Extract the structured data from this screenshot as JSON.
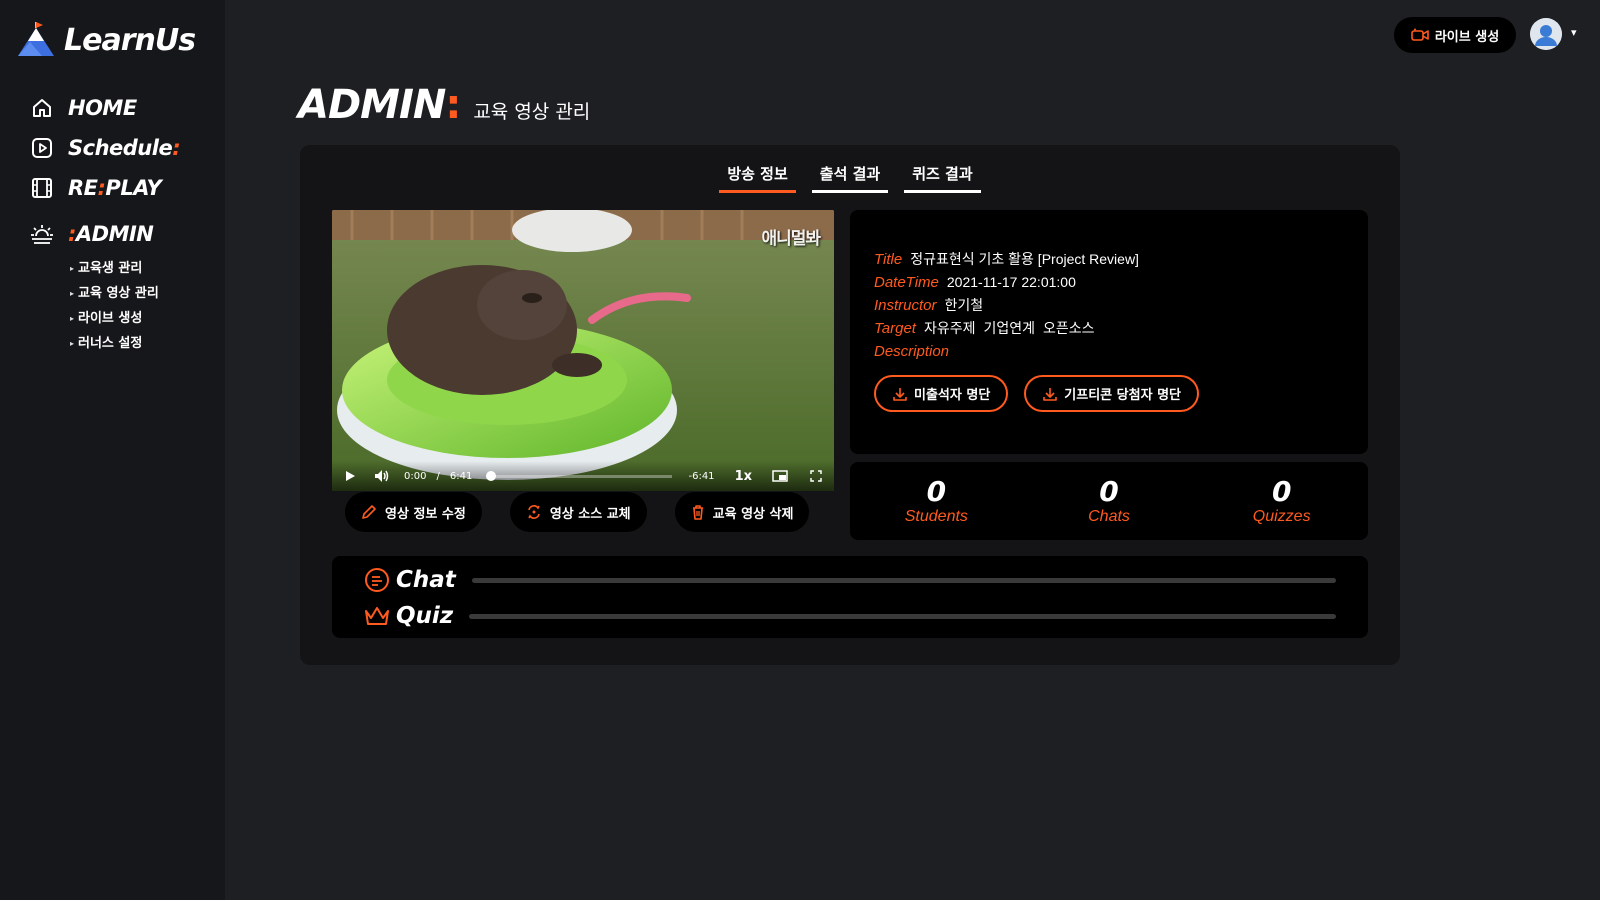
{
  "brand": {
    "name": "LearnUs"
  },
  "nav": {
    "home": "HOME",
    "schedule": "Schedule",
    "schedule_colon": ":",
    "replay_pre": "RE",
    "replay_colon": ":",
    "replay_post": "PLAY",
    "admin_colon": ":",
    "admin": "ADMIN",
    "sub": [
      "교육생 관리",
      "교육 영상 관리",
      "라이브 생성",
      "러너스 설정"
    ]
  },
  "topbar": {
    "live_label": "라이브 생성",
    "avatar_caret": "▾"
  },
  "page": {
    "title": "ADMIN",
    "title_colon": ":",
    "subtitle": "교육 영상 관리"
  },
  "tabs": [
    "방송 정보",
    "출석 결과",
    "퀴즈 결과"
  ],
  "video": {
    "watermark": "애니멀봐",
    "current_time": "0:00",
    "separator": "/",
    "duration": "6:41",
    "remaining": "-6:41",
    "speed": "1x"
  },
  "video_actions": [
    "영상 정보 수정",
    "영상 소스 교체",
    "교육 영상 삭제"
  ],
  "info": {
    "title_key": "Title",
    "title_val": "정규표현식 기초 활용 [Project Review]",
    "datetime_key": "DateTime",
    "datetime_val": "2021-11-17 22:01:00",
    "instructor_key": "Instructor",
    "instructor_val": "한기철",
    "target_key": "Target",
    "target_tags": [
      "자유주제",
      "기업연계",
      "오픈소스"
    ],
    "description_key": "Description",
    "download_absent": "미출석자 명단",
    "download_gift": "기프티콘 당첨자 명단"
  },
  "stats": [
    {
      "value": "0",
      "label": "Students"
    },
    {
      "value": "0",
      "label": "Chats"
    },
    {
      "value": "0",
      "label": "Quizzes"
    }
  ],
  "activity": {
    "chat": "Chat",
    "quiz": "Quiz"
  },
  "colors": {
    "accent": "#ff5a1f",
    "background": "#1e1f23",
    "sidebar": "#16171a",
    "panel": "#000000"
  }
}
